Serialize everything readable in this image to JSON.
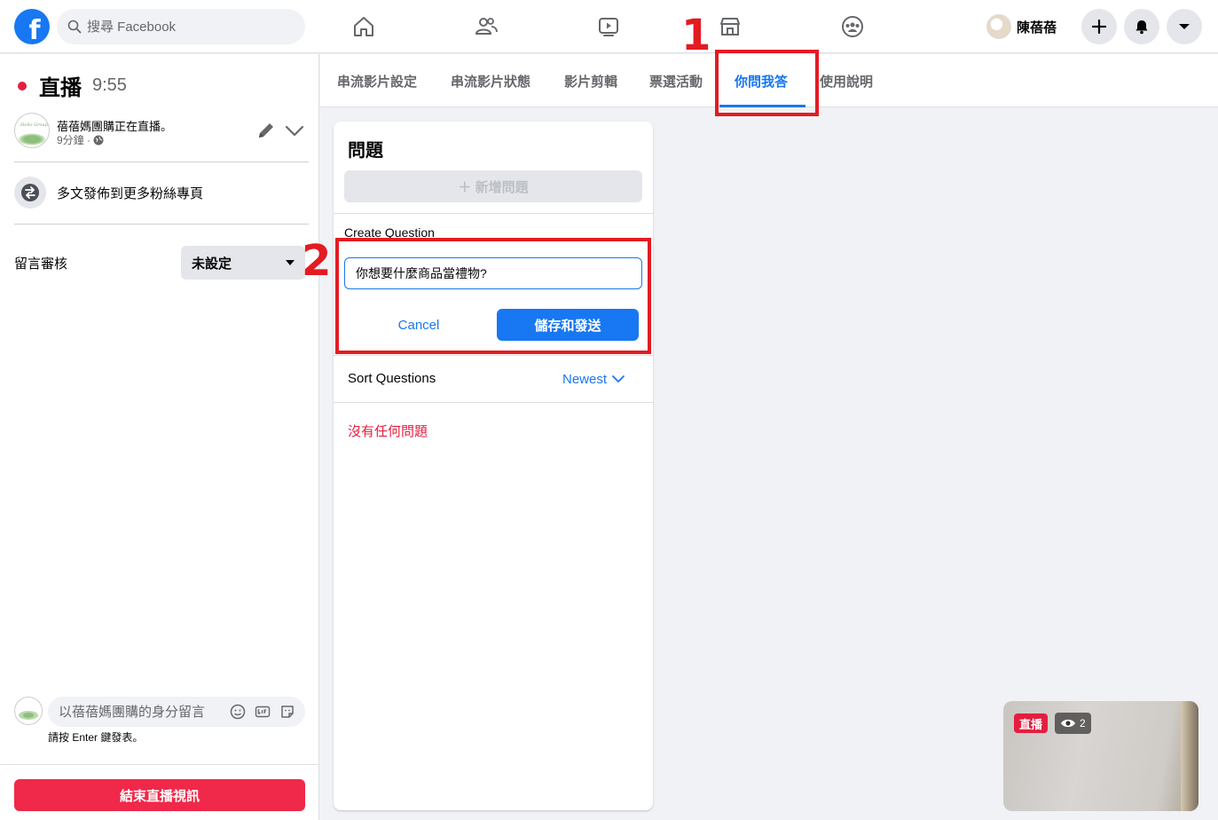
{
  "topbar": {
    "logo_letter": "f",
    "search_placeholder": "搜尋 Facebook",
    "profile_name": "陳蓓蓓"
  },
  "sidebar": {
    "live_label": "直播",
    "live_time": "9:55",
    "page_status": "蓓蓓媽團購正在直播。",
    "page_meta": "9分鐘 ·",
    "crosspost_label": "多文發佈到更多粉絲專頁",
    "moderation_label": "留言審核",
    "moderation_value": "未設定",
    "comment_placeholder": "以蓓蓓媽團購的身分留言",
    "comment_hint": "請按 Enter 鍵發表。",
    "end_button": "結束直播視訊",
    "avatar_text": "Hello Group"
  },
  "tabs": [
    {
      "label": "串流影片設定"
    },
    {
      "label": "串流影片狀態"
    },
    {
      "label": "影片剪輯"
    },
    {
      "label": "票選活動"
    },
    {
      "label": "你問我答"
    },
    {
      "label": "使用說明"
    }
  ],
  "panel": {
    "title": "問題",
    "add_question": "＋ 新增問題",
    "create_label": "Create Question",
    "question_value": "你想要什麼商品當禮物?",
    "cancel": "Cancel",
    "save_send": "儲存和發送",
    "sort_label": "Sort Questions",
    "sort_value": "Newest",
    "empty_message": "沒有任何問題"
  },
  "annotations": {
    "step1": "1",
    "step2": "2"
  },
  "preview": {
    "live_badge": "直播",
    "viewer_count": "2"
  },
  "colors": {
    "brand": "#1877f2",
    "live_red": "#e41e3f",
    "annotation_red": "#e31b23"
  }
}
